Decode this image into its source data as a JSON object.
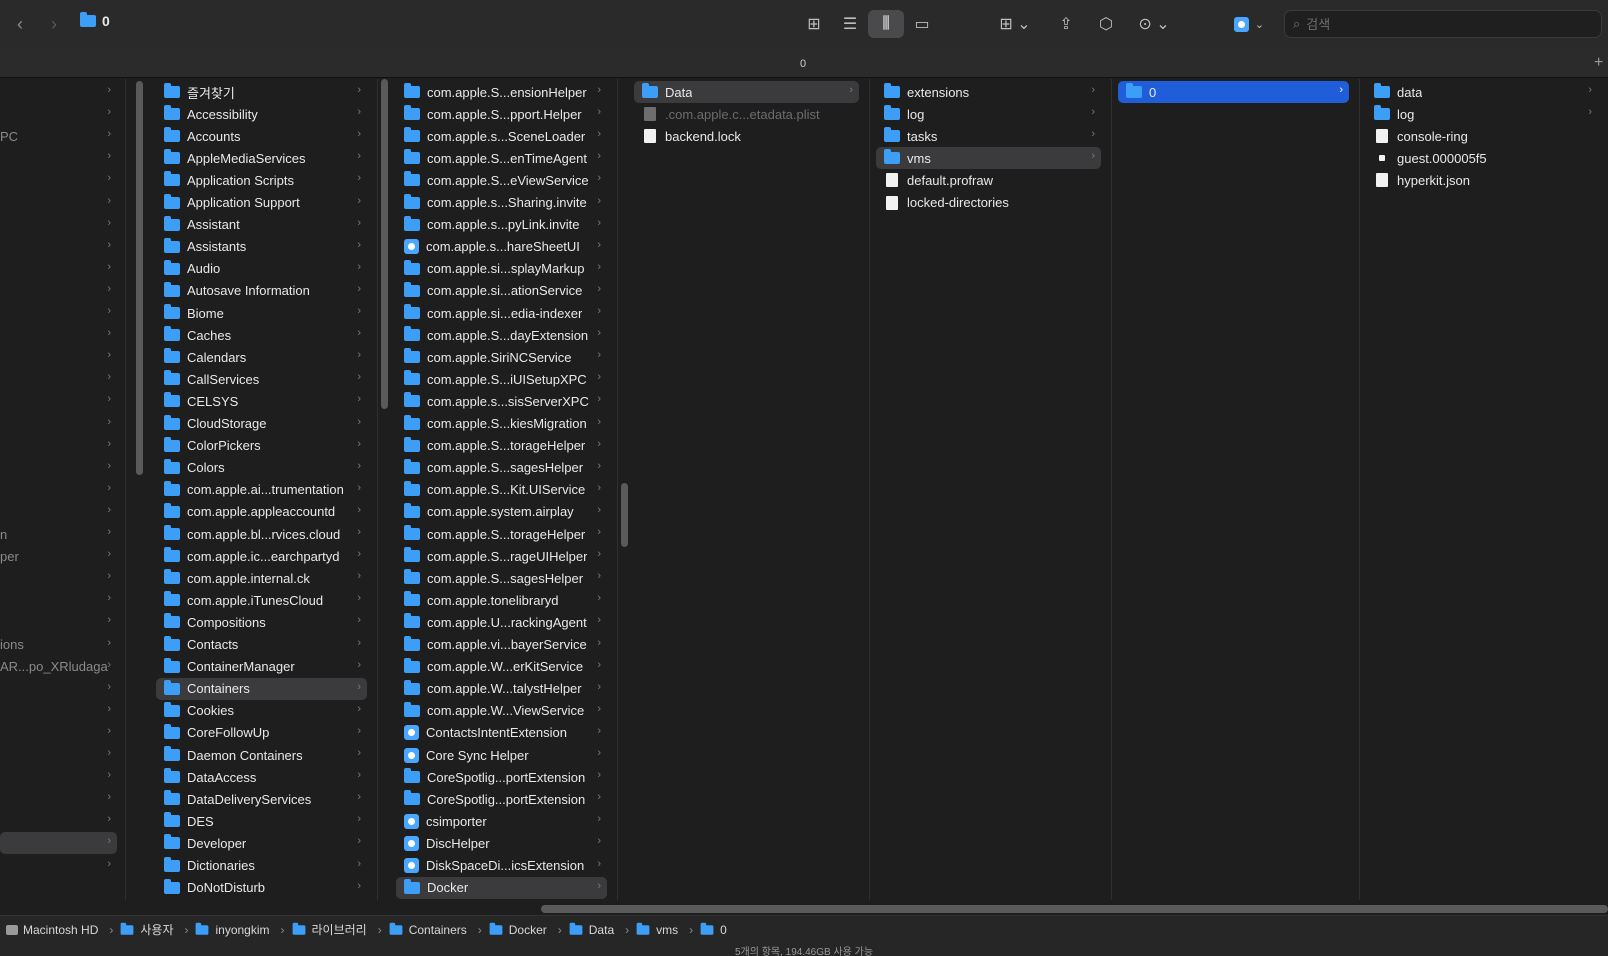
{
  "window": {
    "title": "0"
  },
  "toolbar": {
    "view_icons": [
      "icon-view-icon",
      "list-view-icon",
      "column-view-icon",
      "gallery-view-icon"
    ],
    "search_placeholder": "검색"
  },
  "tabbar": {
    "label": "0"
  },
  "columns": {
    "col0": {
      "rows": [
        {
          "label": ""
        },
        {
          "label": ""
        },
        {
          "label": "PC"
        },
        {
          "label": ""
        },
        {
          "label": ""
        },
        {
          "label": ""
        },
        {
          "label": ""
        },
        {
          "label": ""
        },
        {
          "label": ""
        },
        {
          "label": ""
        },
        {
          "label": ""
        },
        {
          "label": ""
        },
        {
          "label": ""
        },
        {
          "label": ""
        },
        {
          "label": ""
        },
        {
          "label": ""
        },
        {
          "label": ""
        },
        {
          "label": ""
        },
        {
          "label": ""
        },
        {
          "label": ""
        },
        {
          "label": "n"
        },
        {
          "label": "per"
        },
        {
          "label": ""
        },
        {
          "label": ""
        },
        {
          "label": ""
        },
        {
          "label": "ions"
        },
        {
          "label": "AR...po_XRludaga"
        },
        {
          "label": ""
        },
        {
          "label": ""
        },
        {
          "label": ""
        },
        {
          "label": ""
        },
        {
          "label": ""
        },
        {
          "label": ""
        },
        {
          "label": ""
        },
        {
          "label": ""
        },
        {
          "label": ""
        }
      ]
    },
    "col1": {
      "items": [
        "즐겨찾기",
        "Accessibility",
        "Accounts",
        "AppleMediaServices",
        "Application Scripts",
        "Application Support",
        "Assistant",
        "Assistants",
        "Audio",
        "Autosave Information",
        "Biome",
        "Caches",
        "Calendars",
        "CallServices",
        "CELSYS",
        "CloudStorage",
        "ColorPickers",
        "Colors",
        "com.apple.ai...trumentation",
        "com.apple.appleaccountd",
        "com.apple.bl...rvices.cloud",
        "com.apple.ic...earchpartyd",
        "com.apple.internal.ck",
        "com.apple.iTunesCloud",
        "Compositions",
        "Contacts",
        "ContainerManager",
        "Containers",
        "Cookies",
        "CoreFollowUp",
        "Daemon Containers",
        "DataAccess",
        "DataDeliveryServices",
        "DES",
        "Developer",
        "Dictionaries",
        "DoNotDisturb"
      ],
      "selected": "Containers"
    },
    "col2": {
      "items": [
        "com.apple.S...ensionHelper",
        "com.apple.S...pport.Helper",
        "com.apple.s...SceneLoader",
        "com.apple.S...enTimeAgent",
        "com.apple.S...eViewService",
        "com.apple.s...Sharing.invite",
        "com.apple.s...pyLink.invite",
        "com.apple.s...hareSheetUI",
        "com.apple.si...splayMarkup",
        "com.apple.si...ationService",
        "com.apple.si...edia-indexer",
        "com.apple.S...dayExtension",
        "com.apple.SiriNCService",
        "com.apple.S...iUISetupXPC",
        "com.apple.s...sisServerXPC",
        "com.apple.S...kiesMigration",
        "com.apple.S...torageHelper",
        "com.apple.S...sagesHelper",
        "com.apple.S...Kit.UIService",
        "com.apple.system.airplay",
        "com.apple.S...torageHelper",
        "com.apple.S...rageUIHelper",
        "com.apple.S...sagesHelper",
        "com.apple.tonelibraryd",
        "com.apple.U...rackingAgent",
        "com.apple.vi...bayerService",
        "com.apple.W...erKitService",
        "com.apple.W...talystHelper",
        "com.apple.W...ViewService",
        "ContactsIntentExtension",
        "Core Sync Helper",
        "CoreSpotlig...portExtension",
        "CoreSpotlig...portExtension",
        "csimporter",
        "DiscHelper",
        "DiskSpaceDi...icsExtension",
        "Docker"
      ],
      "app_items": [
        "com.apple.s...hareSheetUI",
        "ContactsIntentExtension",
        "Core Sync Helper",
        "csimporter",
        "DiscHelper",
        "DiskSpaceDi...icsExtension"
      ],
      "selected": "Docker"
    },
    "col3": {
      "items": [
        {
          "label": "Data",
          "kind": "folder",
          "chevron": true
        },
        {
          "label": ".com.apple.c...etadata.plist",
          "kind": "file-dim",
          "chevron": false
        },
        {
          "label": "backend.lock",
          "kind": "file",
          "chevron": false
        }
      ],
      "selected": "Data"
    },
    "col4": {
      "items": [
        {
          "label": "extensions",
          "kind": "folder",
          "chevron": true
        },
        {
          "label": "log",
          "kind": "folder",
          "chevron": true
        },
        {
          "label": "tasks",
          "kind": "folder",
          "chevron": true
        },
        {
          "label": "vms",
          "kind": "folder",
          "chevron": true
        },
        {
          "label": "default.profraw",
          "kind": "file",
          "chevron": false
        },
        {
          "label": "locked-directories",
          "kind": "file",
          "chevron": false
        }
      ],
      "selected": "vms"
    },
    "col5": {
      "items": [
        {
          "label": "0",
          "kind": "folder",
          "chevron": true
        }
      ],
      "selected": "0"
    },
    "col6": {
      "items": [
        {
          "label": "data",
          "kind": "folder",
          "chevron": true
        },
        {
          "label": "log",
          "kind": "folder",
          "chevron": true
        },
        {
          "label": "console-ring",
          "kind": "file",
          "chevron": false
        },
        {
          "label": "guest.000005f5",
          "kind": "socket",
          "chevron": false
        },
        {
          "label": "hyperkit.json",
          "kind": "file",
          "chevron": false
        }
      ]
    }
  },
  "pathbar": {
    "crumbs": [
      {
        "label": "Macintosh HD",
        "icon": "disk"
      },
      {
        "label": "사용자",
        "icon": "folder"
      },
      {
        "label": "inyongkim",
        "icon": "folder"
      },
      {
        "label": "라이브러리",
        "icon": "folder"
      },
      {
        "label": "Containers",
        "icon": "folder"
      },
      {
        "label": "Docker",
        "icon": "folder"
      },
      {
        "label": "Data",
        "icon": "folder"
      },
      {
        "label": "vms",
        "icon": "folder"
      },
      {
        "label": "0",
        "icon": "folder"
      }
    ]
  },
  "statusbar": {
    "text": "5개의 항목, 194.46GB 사용 가능"
  },
  "colors": {
    "accent": "#1f5ed8",
    "folder": "#3d9ef7",
    "selection_grey": "#3b3b3d"
  }
}
